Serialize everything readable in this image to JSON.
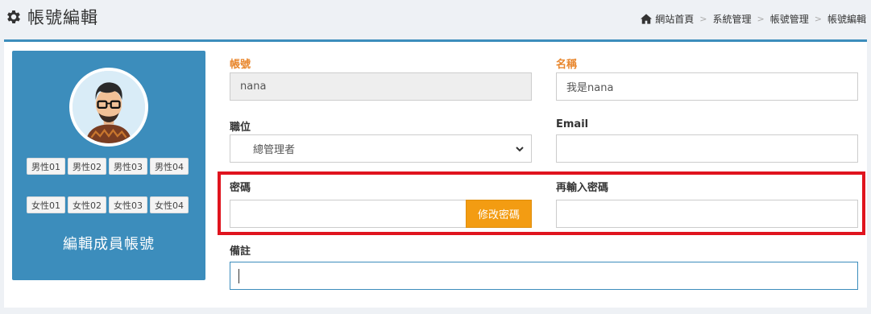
{
  "header": {
    "title": "帳號編輯",
    "icon": "gear-icon",
    "breadcrumb": [
      "網站首頁",
      "系統管理",
      "帳號管理",
      "帳號編輯"
    ],
    "breadcrumb_sep": ">"
  },
  "profile": {
    "male_chips": [
      "男性01",
      "男性02",
      "男性03",
      "男性04"
    ],
    "female_chips": [
      "女性01",
      "女性02",
      "女性03",
      "女性04"
    ],
    "card_title": "編輯成員帳號"
  },
  "form": {
    "account_label": "帳號",
    "account_value": "nana",
    "name_label": "名稱",
    "name_value": "我是nana",
    "position_label": "職位",
    "position_selected": "總管理者",
    "email_label": "Email",
    "email_value": "",
    "password_label": "密碼",
    "password_value": "",
    "change_password_button": "修改密碼",
    "confirm_password_label": "再輸入密碼",
    "confirm_password_value": "",
    "note_label": "備註",
    "note_value": ""
  },
  "colors": {
    "primary": "#3c8dbc",
    "label_orange": "#e8862c",
    "button_orange": "#f39c12",
    "highlight_red": "#e0141e"
  }
}
